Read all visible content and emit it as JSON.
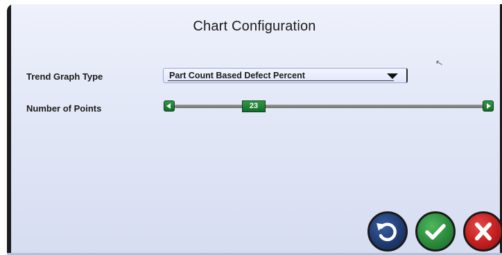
{
  "dialog": {
    "title": "Chart Configuration"
  },
  "trend_graph_type": {
    "label": "Trend Graph Type",
    "selected_value": "Part Count Based Defect Percent"
  },
  "number_of_points": {
    "label": "Number of Points",
    "value": "23",
    "slider_fraction": 0.23
  },
  "actions": {
    "reset_icon": "undo-icon",
    "confirm_icon": "check-icon",
    "cancel_icon": "x-icon"
  },
  "colors": {
    "accent_green": "#1f7a33",
    "reset_blue": "#1f3b72",
    "cancel_red": "#c21e1e"
  }
}
